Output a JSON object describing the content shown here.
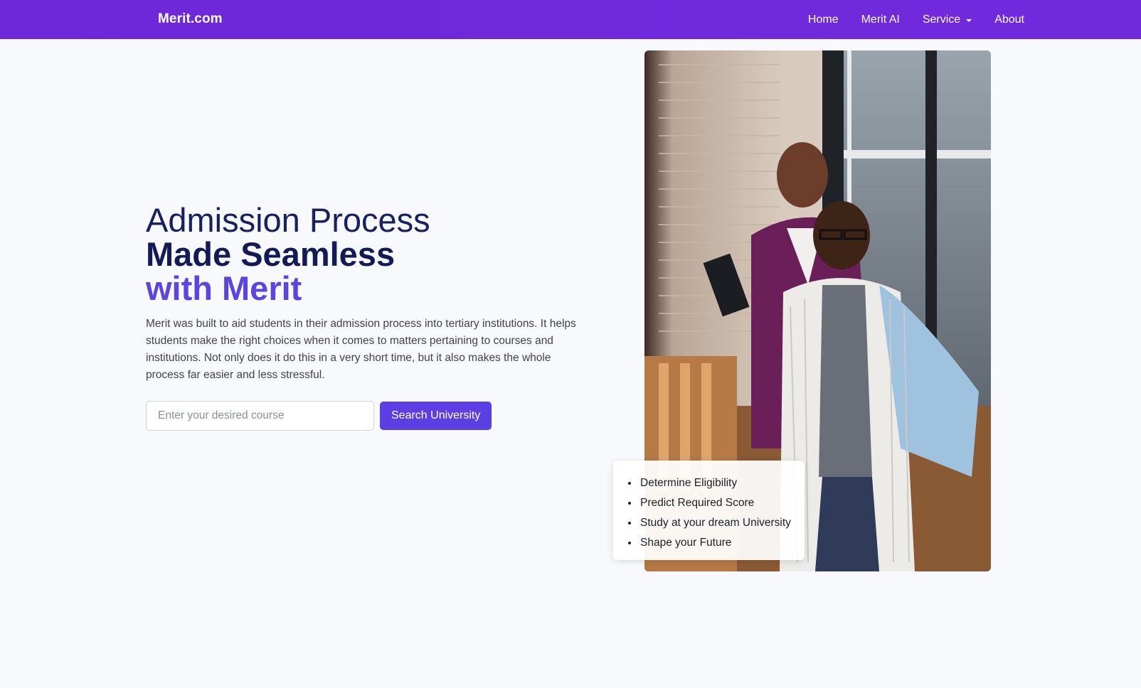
{
  "navbar": {
    "brand": "Merit.com",
    "links": [
      {
        "label": "Home"
      },
      {
        "label": "Merit AI"
      },
      {
        "label": "Service",
        "icon": "caret-down-icon"
      },
      {
        "label": "About"
      }
    ]
  },
  "hero": {
    "title_line_1": "Admission Process",
    "title_line_2": "Made Seamless",
    "title_line_3": "with Merit",
    "description": "Merit was built to aid students in their admission process into tertiary institutions. It helps students make the right choices when it comes to matters pertaining to courses and institutions. Not only does it do this in a very short time, but it also makes the whole process far easier and less stressful.",
    "search": {
      "placeholder": "Enter your desired course",
      "value": "",
      "button_label": "Search University"
    }
  },
  "features": {
    "items": [
      "Determine Eligibility",
      "Predict Required Score",
      "Study at your dream University",
      "Shape your Future"
    ]
  },
  "colors": {
    "navbar": "#6d28d9",
    "title_dark": "#131b57",
    "title_accent": "#5b45e0",
    "button": "#5b3fe3",
    "background": "#f8f9fc"
  }
}
